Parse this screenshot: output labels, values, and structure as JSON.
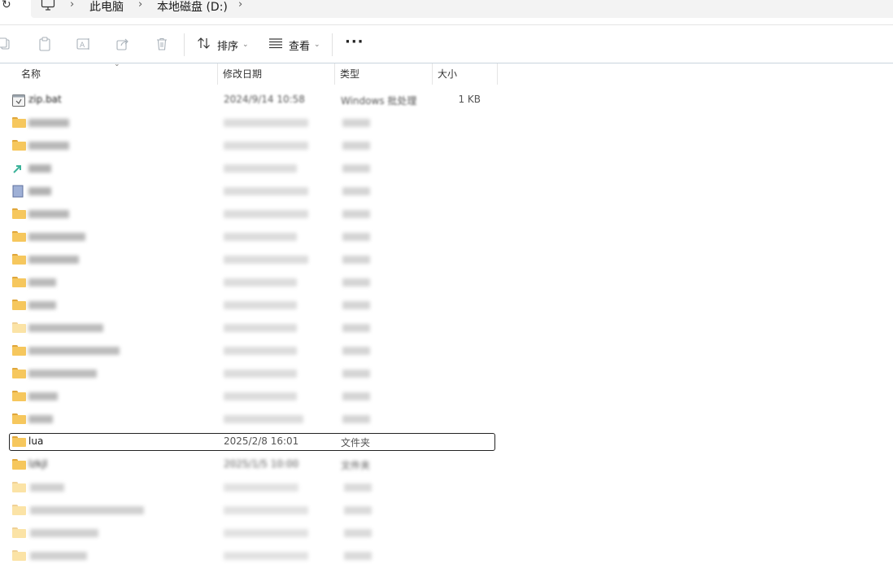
{
  "address_bar": {
    "refresh_icon": "refresh-icon",
    "pc_icon": "monitor-icon",
    "crumbs": [
      "此电脑",
      "本地磁盘 (D:)"
    ]
  },
  "toolbar": {
    "sort_label": "排序",
    "view_label": "查看",
    "more_label": "···"
  },
  "columns": [
    "名称",
    "修改日期",
    "类型",
    "大小"
  ],
  "rows": [
    {
      "name": "zip.bat",
      "date": "2024/9/14 10:58",
      "type": "Windows 批处理",
      "size": "1 KB"
    },
    {
      "name": "lua",
      "date": "2025/2/8 16:01",
      "type": "文件夹",
      "size": ""
    },
    {
      "name": "lzkjl",
      "date": "2025/1/5 10:00",
      "type": "文件夹",
      "size": ""
    }
  ]
}
